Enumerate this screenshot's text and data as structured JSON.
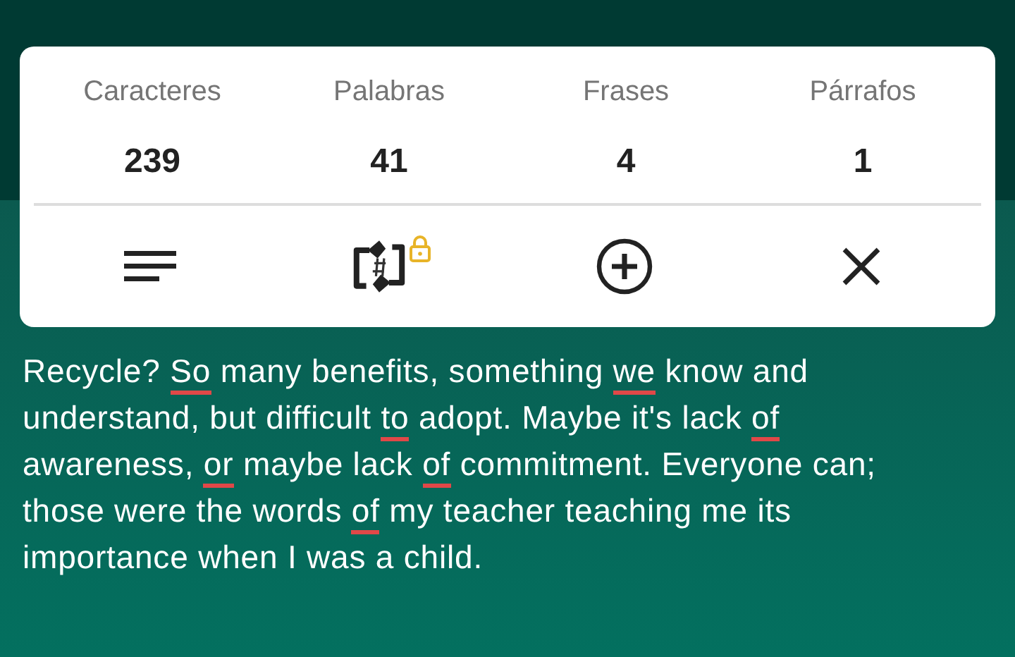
{
  "stats": [
    {
      "label": "Caracteres",
      "value": "239"
    },
    {
      "label": "Palabras",
      "value": "41"
    },
    {
      "label": "Frases",
      "value": "4"
    },
    {
      "label": "Párrafos",
      "value": "1"
    }
  ],
  "toolbar": [
    {
      "kind": "format",
      "locked": false
    },
    {
      "kind": "hashtag",
      "locked": true
    },
    {
      "kind": "add",
      "locked": false
    },
    {
      "kind": "close",
      "locked": false
    }
  ],
  "text": [
    {
      "text": "Recycle? ",
      "misspelled": false
    },
    {
      "text": "So",
      "misspelled": true
    },
    {
      "text": " many benefits, something ",
      "misspelled": false
    },
    {
      "text": "we",
      "misspelled": true
    },
    {
      "text": " know and understand, but difficult ",
      "misspelled": false
    },
    {
      "text": "to",
      "misspelled": true
    },
    {
      "text": " adopt. Maybe it's lack ",
      "misspelled": false
    },
    {
      "text": "of",
      "misspelled": true
    },
    {
      "text": " awareness, ",
      "misspelled": false
    },
    {
      "text": "or",
      "misspelled": true
    },
    {
      "text": " maybe lack ",
      "misspelled": false
    },
    {
      "text": "of",
      "misspelled": true
    },
    {
      "text": " commitment. Everyone can; those were the words ",
      "misspelled": false
    },
    {
      "text": "of",
      "misspelled": true
    },
    {
      "text": " my teacher teaching me its importance when I was a child.",
      "misspelled": false
    }
  ]
}
